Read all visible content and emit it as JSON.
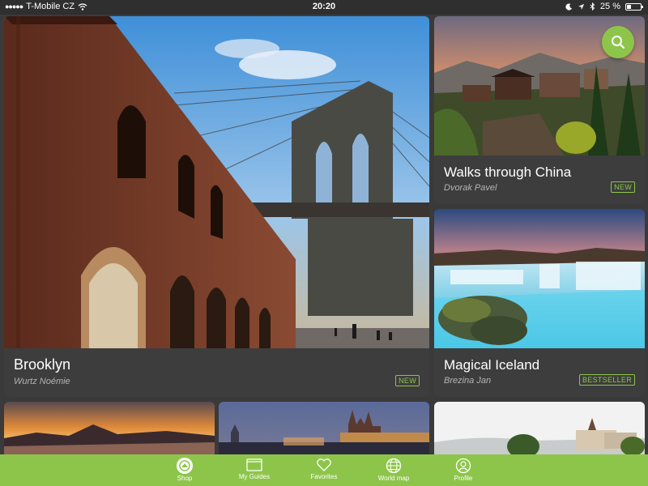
{
  "status_bar": {
    "carrier": "T-Mobile CZ",
    "time": "20:20",
    "battery_text": "25 %",
    "battery_level": 0.25,
    "icons": [
      "signal-dots-icon",
      "wifi-icon",
      "moon-icon",
      "location-icon",
      "bluetooth-icon",
      "battery-icon"
    ]
  },
  "cards": {
    "brooklyn": {
      "title": "Brooklyn",
      "author": "Wurtz Noémie",
      "badge": "NEW"
    },
    "china": {
      "title": "Walks through China",
      "author": "Dvorak Pavel",
      "badge": "NEW"
    },
    "iceland": {
      "title": "Magical Iceland",
      "author": "Brezina Jan",
      "badge": "BESTSELLER"
    }
  },
  "search": {
    "icon": "search-icon"
  },
  "tabbar": {
    "tabs": [
      {
        "label": "Shop",
        "icon": "shop-icon",
        "active": true
      },
      {
        "label": "My Guides",
        "icon": "guides-icon",
        "active": false
      },
      {
        "label": "Favorites",
        "icon": "heart-icon",
        "active": false
      },
      {
        "label": "World map",
        "icon": "globe-icon",
        "active": false
      },
      {
        "label": "Profile",
        "icon": "profile-icon",
        "active": false
      }
    ]
  },
  "colors": {
    "accent": "#8dc54a",
    "card_bg": "#3d3d3d",
    "page_bg": "#3a3a3a"
  }
}
